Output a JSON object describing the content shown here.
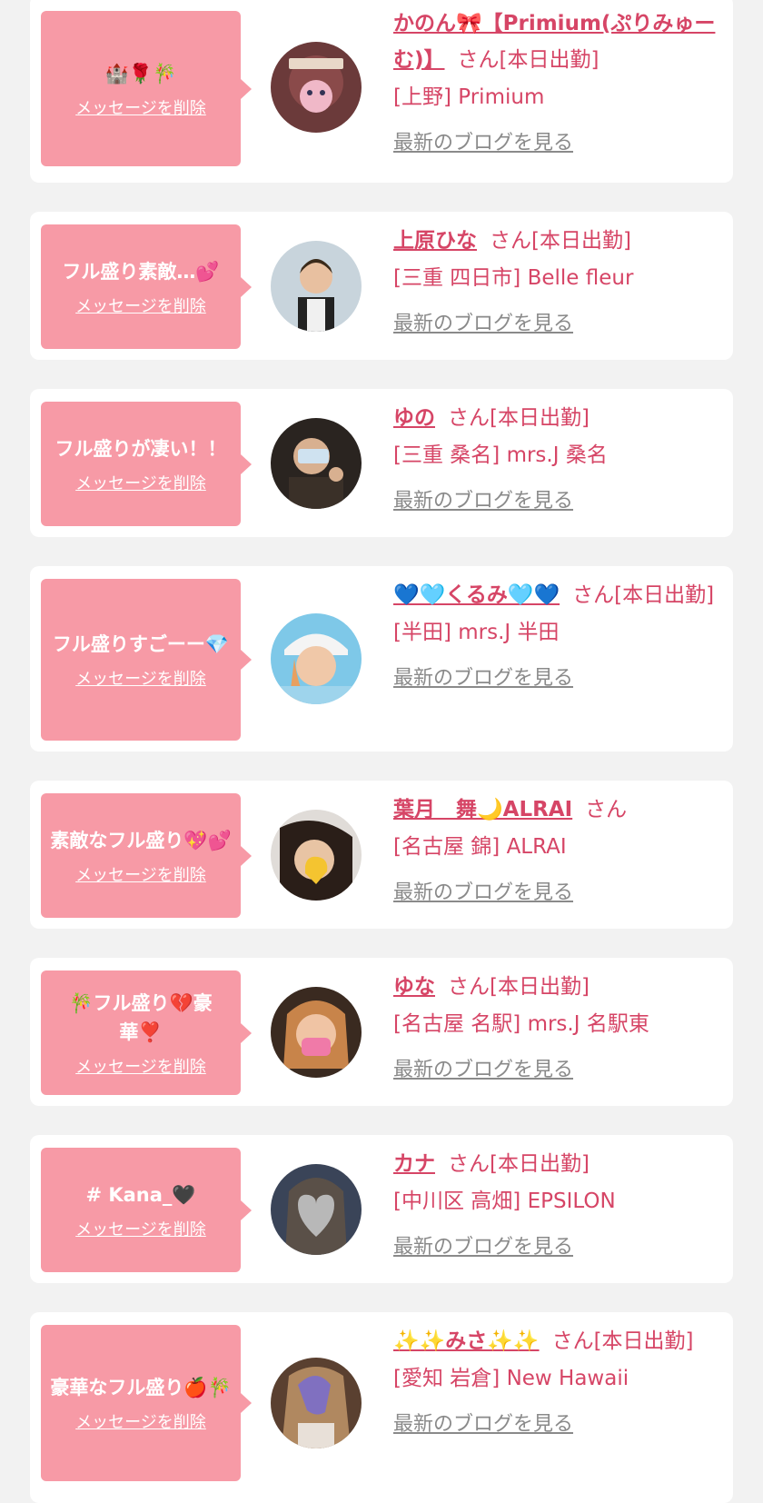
{
  "items": [
    {
      "message": "🏰🌹🎋",
      "delete_label": "メッセージを削除",
      "name": "かのん🎀【Primium(ぷりみゅーむ)】",
      "suffix": "さん[本日出勤]",
      "shop": "[上野] Primium",
      "blog_label": "最新のブログを見る"
    },
    {
      "message": "フル盛り素敵…💕",
      "delete_label": "メッセージを削除",
      "name": "上原ひな",
      "suffix": "さん[本日出勤]",
      "shop": "[三重 四日市] Belle fleur",
      "blog_label": "最新のブログを見る"
    },
    {
      "message": "フル盛りが凄い！！",
      "delete_label": "メッセージを削除",
      "name": "ゆの",
      "suffix": "さん[本日出勤]",
      "shop": "[三重 桑名] mrs.J 桑名",
      "blog_label": "最新のブログを見る"
    },
    {
      "message": "フル盛りすごーー💎",
      "delete_label": "メッセージを削除",
      "name": "💙🩵くるみ🩵💙",
      "suffix": "さん[本日出勤]",
      "shop": "[半田] mrs.J 半田",
      "blog_label": "最新のブログを見る"
    },
    {
      "message": "素敵なフル盛り💖💕",
      "delete_label": "メッセージを削除",
      "name": "葉月　舞🌙ALRAI",
      "suffix": "さん",
      "shop": "[名古屋 錦] ALRAI",
      "blog_label": "最新のブログを見る"
    },
    {
      "message": "🎋フル盛り💔豪華❣️",
      "delete_label": "メッセージを削除",
      "name": "ゆな",
      "suffix": "さん[本日出勤]",
      "shop": "[名古屋 名駅] mrs.J 名駅東",
      "blog_label": "最新のブログを見る"
    },
    {
      "message": "# Kana_🖤",
      "delete_label": "メッセージを削除",
      "name": "カナ",
      "suffix": "さん[本日出勤]",
      "shop": "[中川区 高畑] EPSILON",
      "blog_label": "最新のブログを見る"
    },
    {
      "message": "豪華なフル盛り🍎🎋",
      "delete_label": "メッセージを削除",
      "name": "✨✨みさ✨✨",
      "suffix": "さん[本日出勤]",
      "shop": "[愛知 岩倉] New Hawaii",
      "blog_label": "最新のブログを見る"
    }
  ]
}
